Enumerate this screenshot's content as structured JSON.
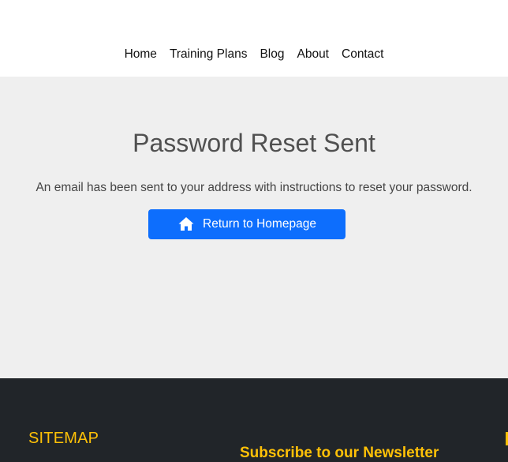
{
  "nav": {
    "items": [
      {
        "label": "Home"
      },
      {
        "label": "Training Plans"
      },
      {
        "label": "Blog"
      },
      {
        "label": "About"
      },
      {
        "label": "Contact"
      }
    ]
  },
  "main": {
    "title": "Password Reset Sent",
    "message": "An email has been sent to your address with instructions to reset your password.",
    "button": {
      "label": "Return to Homepage",
      "icon": "home-icon"
    }
  },
  "footer": {
    "sitemap_heading": "SITEMAP",
    "newsletter_heading": "Subscribe to our Newsletter"
  },
  "colors": {
    "accent": "#0d6efd",
    "footer_bg": "#212529",
    "footer_heading": "#ffc107",
    "main_bg": "#efefef"
  }
}
